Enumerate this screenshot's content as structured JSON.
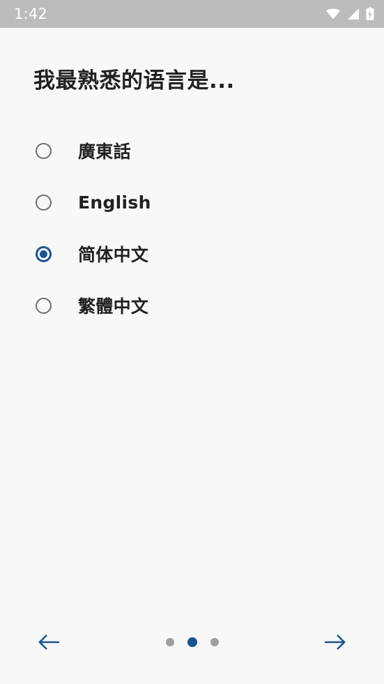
{
  "status_bar": {
    "time": "1:42",
    "background_color": "#bcbcbc",
    "text_color": "#ffffff",
    "icons": [
      "wifi-icon",
      "cell-signal-icon",
      "battery-charging-icon"
    ]
  },
  "screen": {
    "background_color": "#f8f8f8",
    "title": "我最熟悉的语言是..."
  },
  "question": {
    "selected_value": "简体中文",
    "options": [
      {
        "label": "廣東話",
        "selected": false
      },
      {
        "label": "English",
        "selected": false
      },
      {
        "label": "简体中文",
        "selected": true
      },
      {
        "label": "繁體中文",
        "selected": false
      }
    ]
  },
  "bottom_nav": {
    "back_label": "back-arrow",
    "next_label": "forward-arrow",
    "accent_color": "#1a5490",
    "inactive_dot_color": "#9e9e9e",
    "pager": {
      "total": 3,
      "current_index": 2,
      "current_label": "2"
    }
  }
}
